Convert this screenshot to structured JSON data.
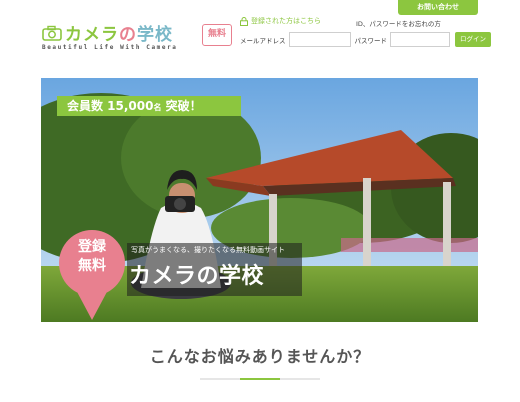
{
  "header": {
    "contact_label": "お問い合わせ",
    "logo": {
      "part1": "カメラ",
      "part2": "の",
      "part3": "学校",
      "tagline": "Beautiful Life With Camera",
      "badge": "無料"
    },
    "login": {
      "heading": "登録された方はこちら",
      "forgot": "ID、パスワードをお忘れの方",
      "email_label": "メールアドレス",
      "password_label": "パスワード",
      "email_value": "",
      "password_value": "",
      "login_button": "ログイン"
    }
  },
  "hero": {
    "members_main": "会員数 15,000",
    "members_small": "名",
    "members_end": " 突破！",
    "registration_line1": "登録",
    "registration_line2": "無料",
    "subtitle": "写真がうまくなる、撮りたくなる無料動画サイト",
    "title": "カメラの学校"
  },
  "section": {
    "question": "こんなお悩みありませんか？"
  },
  "colors": {
    "accent_green": "#8cc63f",
    "accent_pink": "#e8808f",
    "accent_blue": "#7ab8c8"
  }
}
